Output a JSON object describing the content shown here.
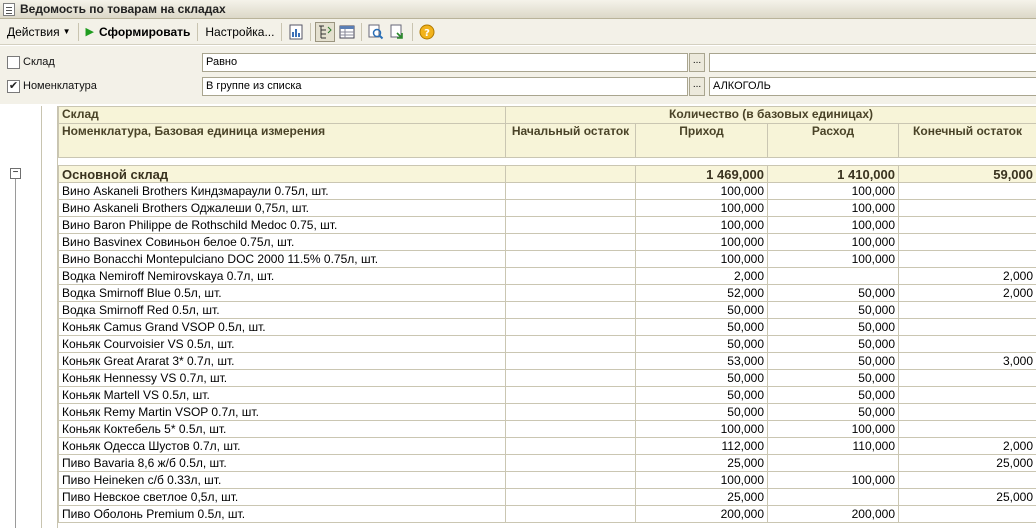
{
  "window": {
    "title": "Ведомость по товарам на складах"
  },
  "toolbar": {
    "actions_label": "Действия",
    "generate_label": "Сформировать",
    "settings_label": "Настройка...",
    "icons": [
      "report-icon",
      "tree-filter-icon",
      "table-settings-icon",
      "search-next-icon",
      "export-icon",
      "help-icon"
    ]
  },
  "filters": {
    "row1": {
      "label": "Склад",
      "checked": "",
      "condition": "Равно",
      "value": ""
    },
    "row2": {
      "label": "Номенклатура",
      "checked": "✔",
      "condition": "В группе из списка",
      "value": "АЛКОГОЛЬ"
    },
    "dots": "..."
  },
  "report": {
    "headers": {
      "warehouse": "Склад",
      "quantity_group": "Количество (в базовых единицах)",
      "item": "Номенклатура, Базовая единица измерения",
      "opening": "Начальный остаток",
      "income": "Приход",
      "expense": "Расход",
      "closing": "Конечный остаток"
    },
    "group": {
      "name": "Основной склад",
      "opening": "",
      "income": "1 469,000",
      "expense": "1 410,000",
      "closing": "59,000",
      "toggle": "−"
    },
    "rows": [
      {
        "name": "Вино Askaneli Brothers Киндзмараули 0.75л, шт.",
        "opening": "",
        "income": "100,000",
        "expense": "100,000",
        "closing": ""
      },
      {
        "name": "Вино Askaneli Brothers Оджалеши 0,75л, шт.",
        "opening": "",
        "income": "100,000",
        "expense": "100,000",
        "closing": ""
      },
      {
        "name": "Вино Baron Philippe de Rothschild Medoc 0.75, шт.",
        "opening": "",
        "income": "100,000",
        "expense": "100,000",
        "closing": ""
      },
      {
        "name": "Вино Basvinex Совиньон белое 0.75л, шт.",
        "opening": "",
        "income": "100,000",
        "expense": "100,000",
        "closing": ""
      },
      {
        "name": "Вино Bonacchi Montepulciano DOC 2000 11.5% 0.75л, шт.",
        "opening": "",
        "income": "100,000",
        "expense": "100,000",
        "closing": ""
      },
      {
        "name": "Водка Nemiroff Nemirovskaya 0.7л, шт.",
        "opening": "",
        "income": "2,000",
        "expense": "",
        "closing": "2,000"
      },
      {
        "name": "Водка Smirnoff Blue 0.5л, шт.",
        "opening": "",
        "income": "52,000",
        "expense": "50,000",
        "closing": "2,000"
      },
      {
        "name": "Водка Smirnoff Red 0.5л, шт.",
        "opening": "",
        "income": "50,000",
        "expense": "50,000",
        "closing": ""
      },
      {
        "name": "Коньяк Camus Grand VSOP 0.5л, шт.",
        "opening": "",
        "income": "50,000",
        "expense": "50,000",
        "closing": ""
      },
      {
        "name": "Коньяк Courvoisier VS 0.5л, шт.",
        "opening": "",
        "income": "50,000",
        "expense": "50,000",
        "closing": ""
      },
      {
        "name": "Коньяк Great Ararat 3* 0.7л, шт.",
        "opening": "",
        "income": "53,000",
        "expense": "50,000",
        "closing": "3,000"
      },
      {
        "name": "Коньяк Hennessy VS 0.7л, шт.",
        "opening": "",
        "income": "50,000",
        "expense": "50,000",
        "closing": ""
      },
      {
        "name": "Коньяк Martell VS 0.5л, шт.",
        "opening": "",
        "income": "50,000",
        "expense": "50,000",
        "closing": ""
      },
      {
        "name": "Коньяк Remy Martin VSOP 0.7л, шт.",
        "opening": "",
        "income": "50,000",
        "expense": "50,000",
        "closing": ""
      },
      {
        "name": "Коньяк Коктебель 5* 0.5л, шт.",
        "opening": "",
        "income": "100,000",
        "expense": "100,000",
        "closing": ""
      },
      {
        "name": "Коньяк Одесса Шустов 0.7л, шт.",
        "opening": "",
        "income": "112,000",
        "expense": "110,000",
        "closing": "2,000"
      },
      {
        "name": "Пиво Bavaria 8,6 ж/б 0.5л, шт.",
        "opening": "",
        "income": "25,000",
        "expense": "",
        "closing": "25,000"
      },
      {
        "name": "Пиво Heineken с/б 0.33л, шт.",
        "opening": "",
        "income": "100,000",
        "expense": "100,000",
        "closing": ""
      },
      {
        "name": "Пиво Невское светлое 0,5л, шт.",
        "opening": "",
        "income": "25,000",
        "expense": "",
        "closing": "25,000"
      },
      {
        "name": "Пиво Оболонь Premium 0.5л, шт.",
        "opening": "",
        "income": "200,000",
        "expense": "200,000",
        "closing": ""
      }
    ]
  }
}
